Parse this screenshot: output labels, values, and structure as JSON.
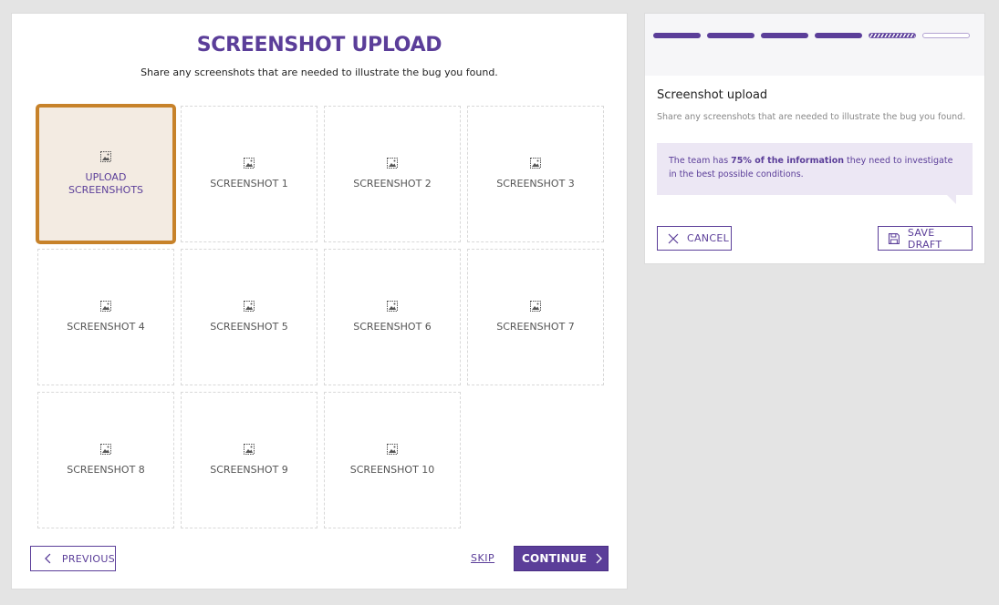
{
  "main": {
    "title": "SCREENSHOT UPLOAD",
    "subtitle": "Share any screenshots that are needed to illustrate the bug you found.",
    "upload_label": "UPLOAD SCREENSHOTS",
    "slots": [
      "SCREENSHOT 1",
      "SCREENSHOT 2",
      "SCREENSHOT 3",
      "SCREENSHOT 4",
      "SCREENSHOT 5",
      "SCREENSHOT 6",
      "SCREENSHOT 7",
      "SCREENSHOT 8",
      "SCREENSHOT 9",
      "SCREENSHOT 10"
    ],
    "previous_label": "PREVIOUS",
    "skip_label": "SKIP",
    "continue_label": "CONTINUE"
  },
  "side": {
    "progress": {
      "total_steps": 6,
      "completed_steps": 4,
      "current_step": 5
    },
    "title": "Screenshot upload",
    "description": "Share any screenshots that are needed to illustrate the bug you found.",
    "info": {
      "prefix": "The team has ",
      "highlight": "75% of the information",
      "suffix": " they need to investigate in the best possible conditions."
    },
    "cancel_label": "CANCEL",
    "save_draft_label": "SAVE DRAFT"
  },
  "colors": {
    "accent": "#5b3e99",
    "highlight_border": "#c7822a",
    "highlight_fill": "#f3ebe2"
  }
}
